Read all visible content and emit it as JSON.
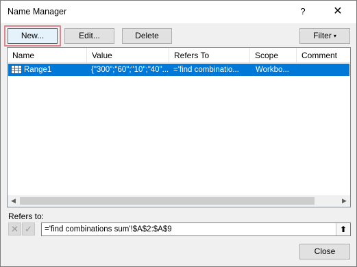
{
  "window": {
    "title": "Name Manager",
    "help_label": "?",
    "close_glyph": "✕"
  },
  "toolbar": {
    "new_label": "New...",
    "edit_label": "Edit...",
    "delete_label": "Delete",
    "filter_label": "Filter",
    "filter_caret": "▾"
  },
  "table": {
    "columns": [
      "Name",
      "Value",
      "Refers To",
      "Scope",
      "Comment"
    ],
    "rows": [
      {
        "name": "Range1",
        "value": "{\"300\";\"60\";\"10\";\"40\"...",
        "refers_to": "='find combinatio...",
        "scope": "Workbo...",
        "comment": "",
        "selected": true
      }
    ],
    "scroll_left": "◀",
    "scroll_right": "▶"
  },
  "refers": {
    "label": "Refers to:",
    "value": "='find combinations sum'!$A$2:$A$9",
    "cancel_glyph": "✕",
    "confirm_glyph": "✓",
    "collapse_glyph": "⬆"
  },
  "footer": {
    "close_label": "Close"
  },
  "colors": {
    "selection": "#0078d7",
    "highlight_outline": "#d9878e"
  }
}
